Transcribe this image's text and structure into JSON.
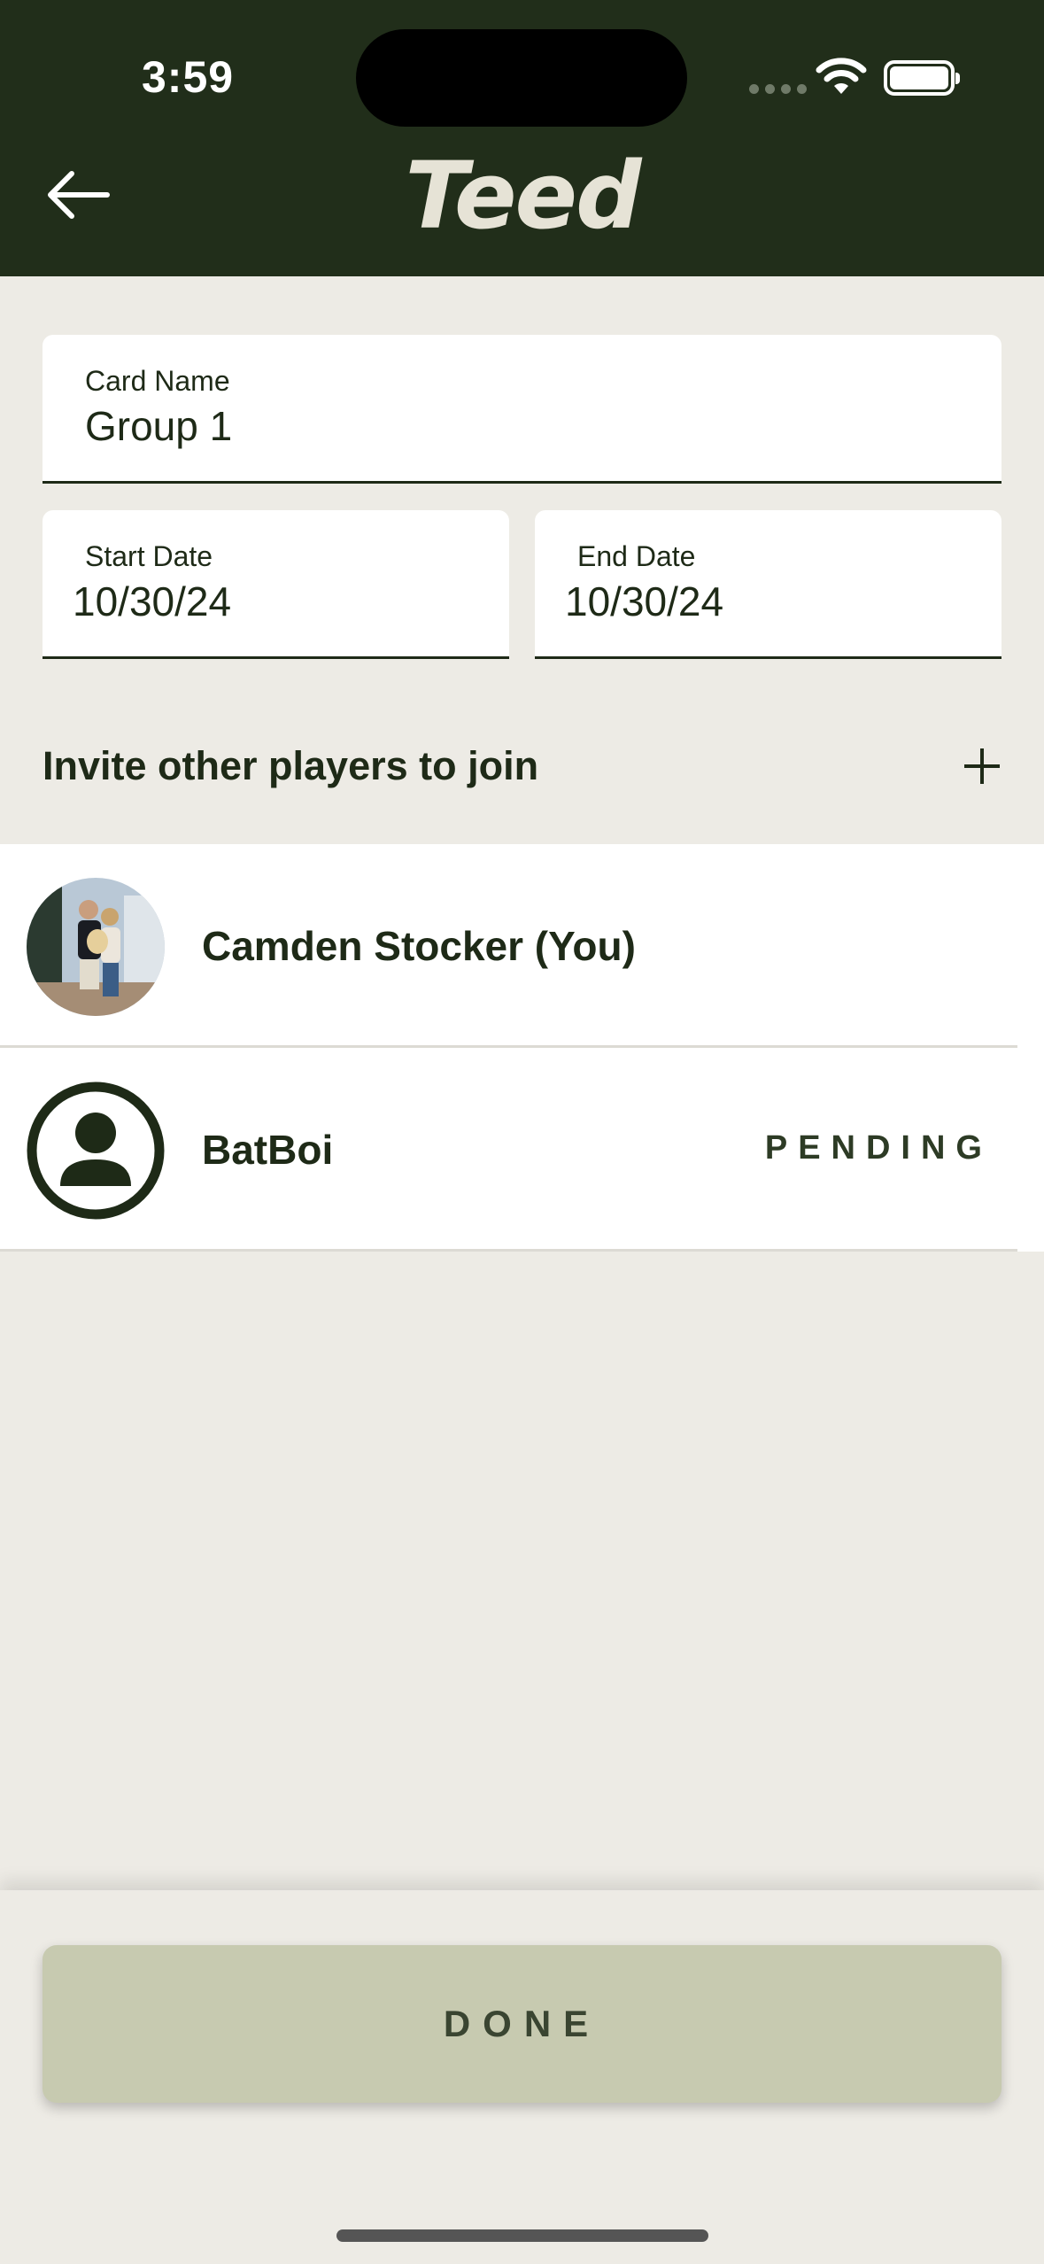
{
  "status_bar": {
    "time": "3:59"
  },
  "header": {
    "logo_text": "Teed",
    "back_icon": "arrow-left-icon"
  },
  "form": {
    "card_name": {
      "label": "Card Name",
      "value": "Group 1"
    },
    "start_date": {
      "label": "Start Date",
      "value": "10/30/24"
    },
    "end_date": {
      "label": "End Date",
      "value": "10/30/24"
    }
  },
  "invite": {
    "label": "Invite other players to join",
    "add_icon": "plus-icon"
  },
  "players": [
    {
      "name": "Camden Stocker (You)",
      "status": "",
      "avatar": "photo"
    },
    {
      "name": "BatBoi",
      "status": "PENDING",
      "avatar": "person-icon"
    }
  ],
  "footer": {
    "done_label": "DONE"
  },
  "colors": {
    "header_bg": "#212e1a",
    "page_bg": "#edebe5",
    "button_bg": "#c7cab0",
    "text_dark": "#1e2a17"
  }
}
